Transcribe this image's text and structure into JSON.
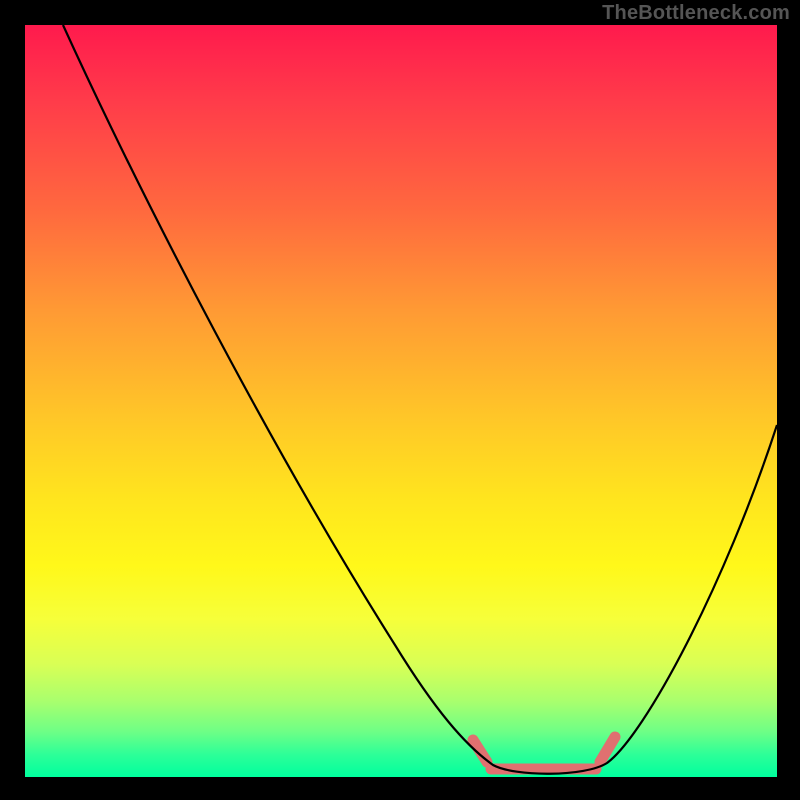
{
  "watermark": "TheBottleneck.com",
  "chart_data": {
    "type": "line",
    "title": "",
    "xlabel": "",
    "ylabel": "",
    "xlim": [
      0,
      100
    ],
    "ylim": [
      0,
      100
    ],
    "series": [
      {
        "name": "bottleneck-curve",
        "x": [
          5,
          10,
          15,
          20,
          25,
          30,
          35,
          40,
          45,
          50,
          55,
          60,
          62,
          65,
          68,
          70,
          73,
          76,
          80,
          85,
          90,
          95,
          100
        ],
        "values": [
          100,
          91,
          82,
          73,
          64,
          55,
          46,
          37,
          28,
          19,
          11,
          3,
          1,
          0,
          0,
          0,
          0,
          1,
          6,
          16,
          28,
          40,
          52
        ]
      },
      {
        "name": "highlight-band",
        "x": [
          60,
          78
        ],
        "values": [
          1,
          1
        ]
      }
    ],
    "background_gradient": {
      "top": "#ff1a4d",
      "mid": "#ffe51e",
      "bottom": "#00ff9e"
    }
  }
}
